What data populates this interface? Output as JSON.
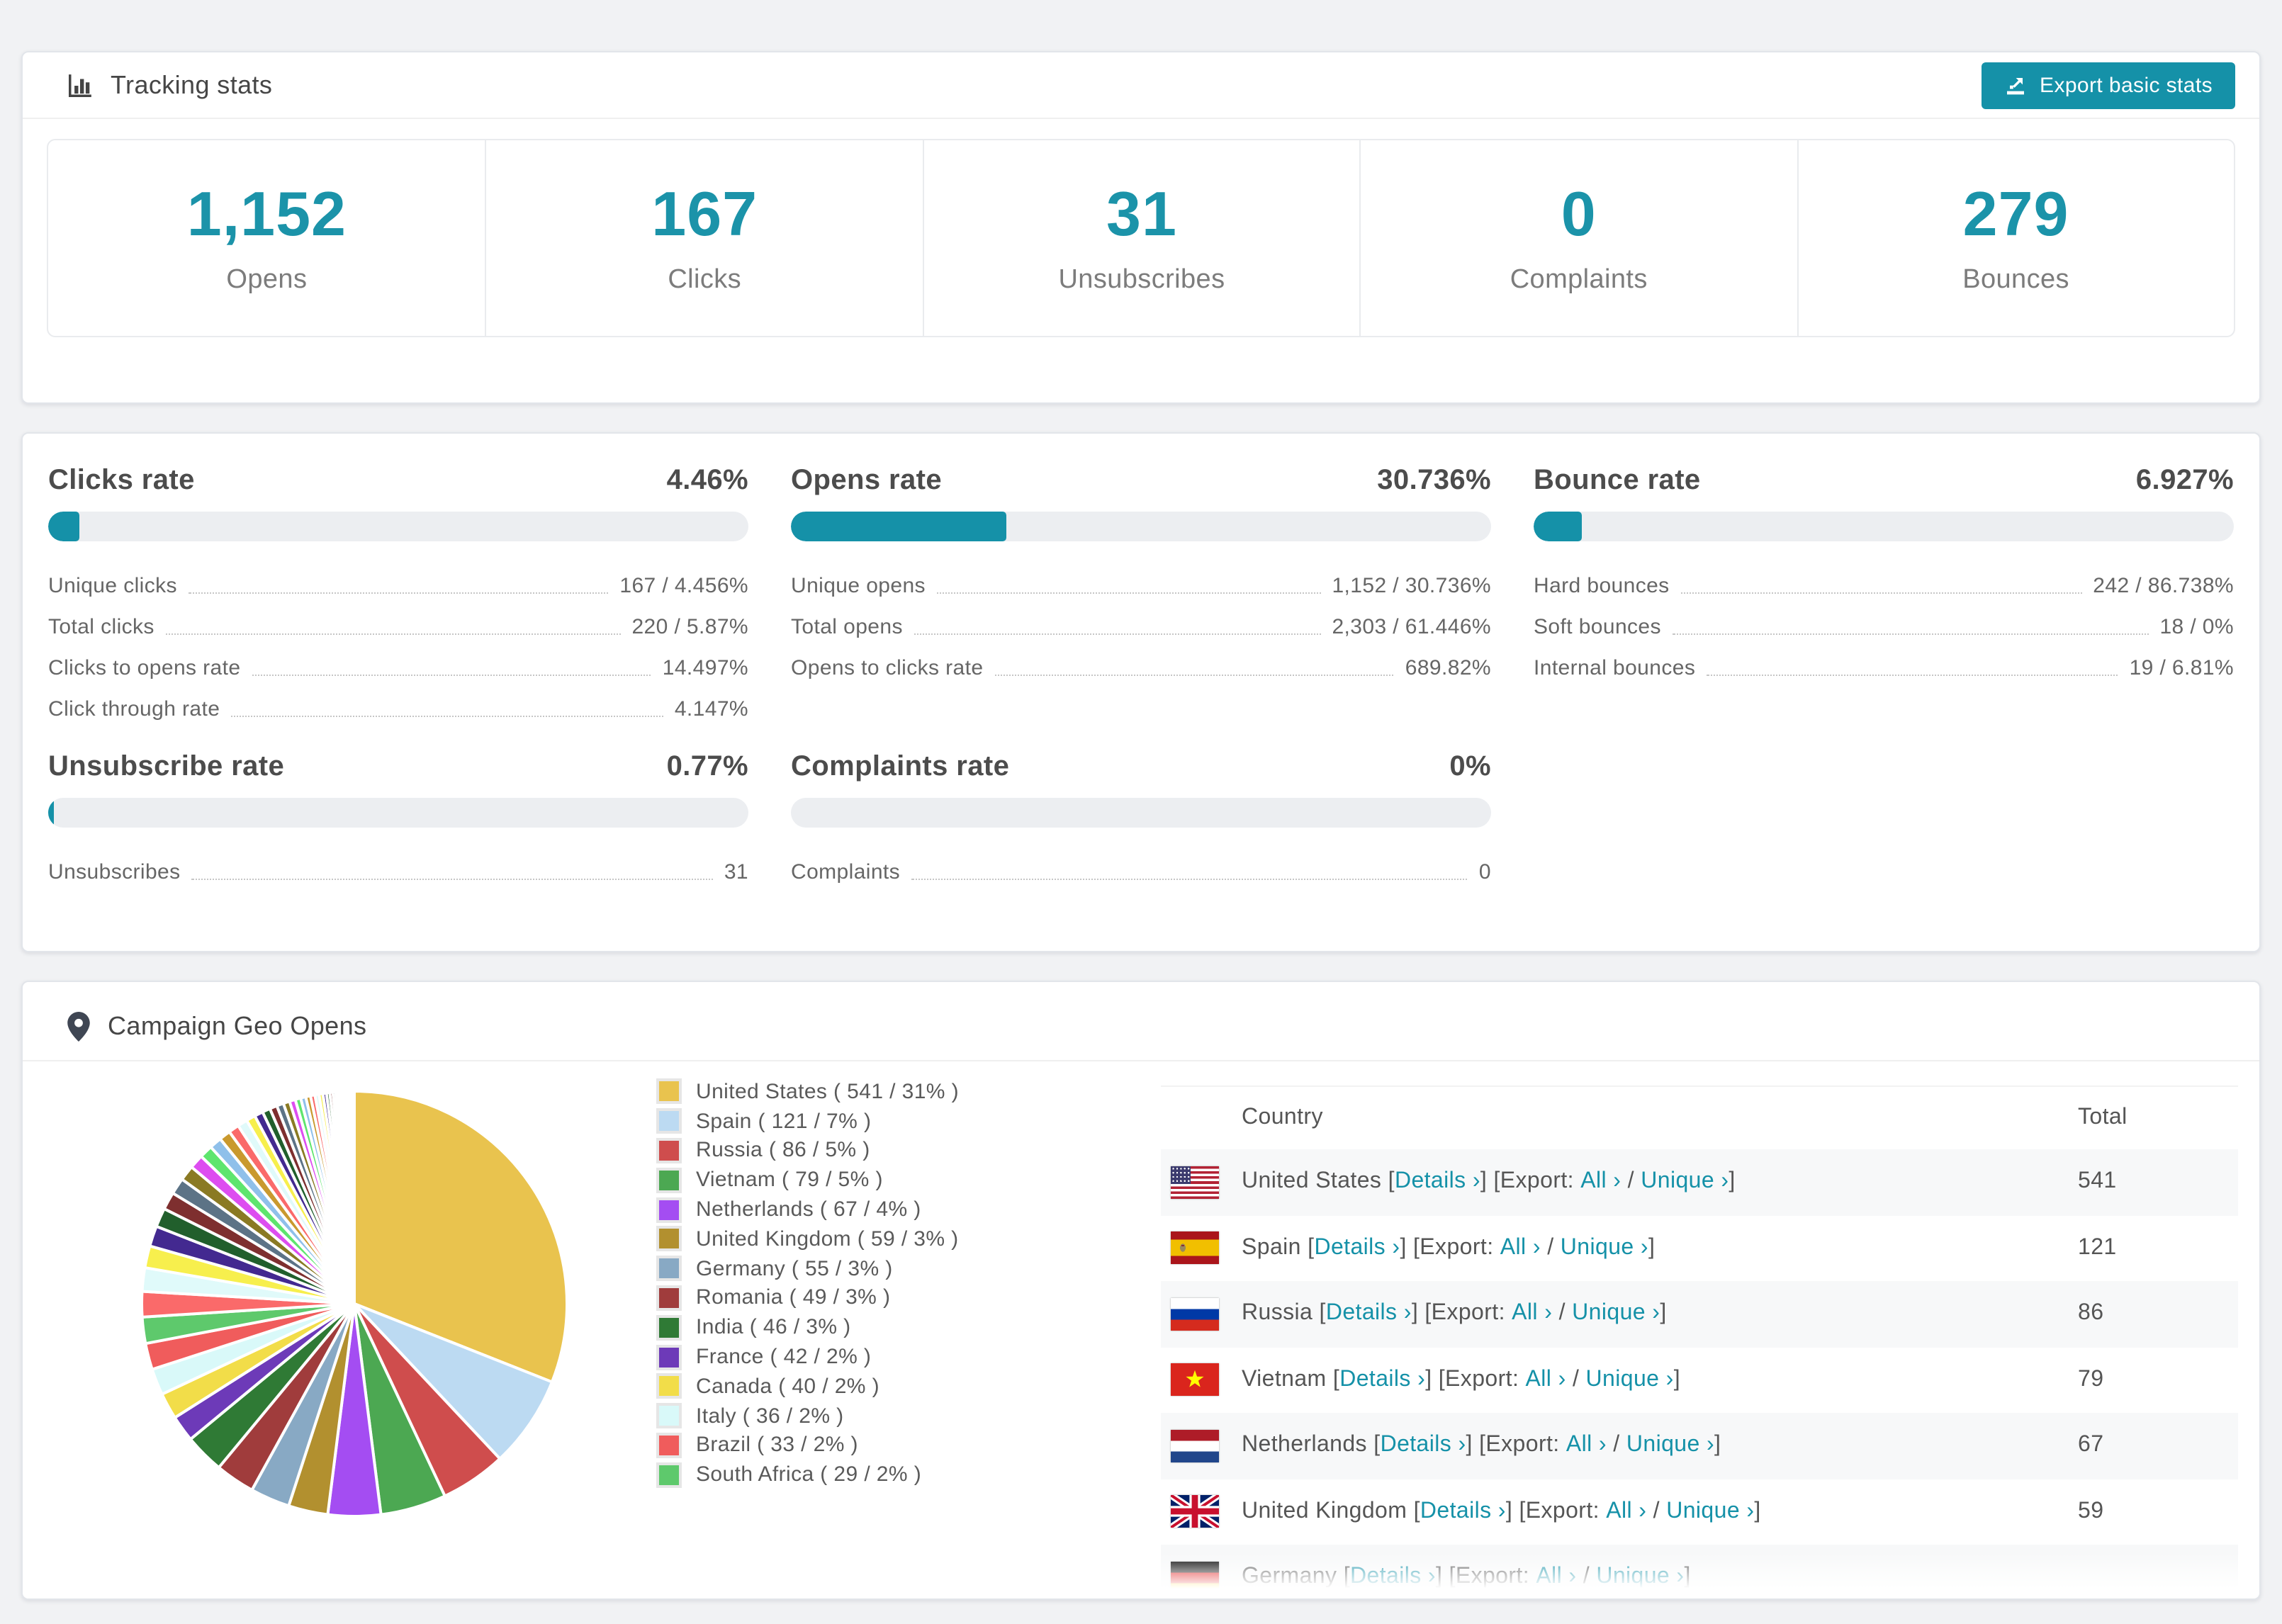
{
  "page_bg": "#f1f2f4",
  "accent": "#1591a8",
  "tracking": {
    "title": "Tracking stats",
    "export_button_label": "Export basic stats",
    "stats": [
      {
        "value": "1,152",
        "label": "Opens"
      },
      {
        "value": "167",
        "label": "Clicks"
      },
      {
        "value": "31",
        "label": "Unsubscribes"
      },
      {
        "value": "0",
        "label": "Complaints"
      },
      {
        "value": "279",
        "label": "Bounces"
      }
    ]
  },
  "rates": [
    {
      "title": "Clicks rate",
      "value": "4.46%",
      "percent": 4.46,
      "rows": [
        {
          "label": "Unique clicks",
          "value": "167 / 4.456%"
        },
        {
          "label": "Total clicks",
          "value": "220 / 5.87%"
        },
        {
          "label": "Clicks to opens rate",
          "value": "14.497%"
        },
        {
          "label": "Click through rate",
          "value": "4.147%"
        }
      ]
    },
    {
      "title": "Opens rate",
      "value": "30.736%",
      "percent": 30.736,
      "rows": [
        {
          "label": "Unique opens",
          "value": "1,152 / 30.736%"
        },
        {
          "label": "Total opens",
          "value": "2,303 / 61.446%"
        },
        {
          "label": "Opens to clicks rate",
          "value": "689.82%"
        }
      ]
    },
    {
      "title": "Bounce rate",
      "value": "6.927%",
      "percent": 6.927,
      "rows": [
        {
          "label": "Hard bounces",
          "value": "242 / 86.738%"
        },
        {
          "label": "Soft bounces",
          "value": "18 / 0%"
        },
        {
          "label": "Internal bounces",
          "value": "19 / 6.81%"
        }
      ]
    },
    {
      "title": "Unsubscribe rate",
      "value": "0.77%",
      "percent": 0.77,
      "rows": [
        {
          "label": "Unsubscribes",
          "value": "31"
        }
      ]
    },
    {
      "title": "Complaints rate",
      "value": "0%",
      "percent": 0,
      "rows": [
        {
          "label": "Complaints",
          "value": "0"
        }
      ]
    }
  ],
  "geo": {
    "title": "Campaign Geo Opens",
    "table": {
      "columns": [
        "Country",
        "Total"
      ],
      "details_label": "Details ›",
      "export_label": "Export:",
      "all_label": "All ›",
      "unique_label": "Unique ›",
      "rows": [
        {
          "country": "United States",
          "flag": "us",
          "total": "541"
        },
        {
          "country": "Spain",
          "flag": "es",
          "total": "121"
        },
        {
          "country": "Russia",
          "flag": "ru",
          "total": "86"
        },
        {
          "country": "Vietnam",
          "flag": "vn",
          "total": "79"
        },
        {
          "country": "Netherlands",
          "flag": "nl",
          "total": "67"
        },
        {
          "country": "United Kingdom",
          "flag": "gb",
          "total": "59"
        },
        {
          "country": "Germany",
          "flag": "de",
          "total": "",
          "partial": true
        }
      ]
    }
  },
  "chart_data": {
    "type": "pie",
    "title": "Campaign Geo Opens",
    "legend_position": "right",
    "start_angle_deg": 0,
    "direction": "clockwise",
    "slices": [
      {
        "label": "United States",
        "count": 541,
        "pct": 31,
        "color": "#e9c34e"
      },
      {
        "label": "Spain",
        "count": 121,
        "pct": 7,
        "color": "#bcdaf2"
      },
      {
        "label": "Russia",
        "count": 86,
        "pct": 5,
        "color": "#cf4d4d"
      },
      {
        "label": "Vietnam",
        "count": 79,
        "pct": 5,
        "color": "#4ca852"
      },
      {
        "label": "Netherlands",
        "count": 67,
        "pct": 4,
        "color": "#a44df2"
      },
      {
        "label": "United Kingdom",
        "count": 59,
        "pct": 3,
        "color": "#b2902f"
      },
      {
        "label": "Germany",
        "count": 55,
        "pct": 3,
        "color": "#88a9c4"
      },
      {
        "label": "Romania",
        "count": 49,
        "pct": 3,
        "color": "#a03c3c"
      },
      {
        "label": "India",
        "count": 46,
        "pct": 3,
        "color": "#2f7a35"
      },
      {
        "label": "France",
        "count": 42,
        "pct": 2,
        "color": "#6d3ab8"
      },
      {
        "label": "Canada",
        "count": 40,
        "pct": 2,
        "color": "#f2dd49"
      },
      {
        "label": "Italy",
        "count": 36,
        "pct": 2,
        "color": "#d9f9f9"
      },
      {
        "label": "Brazil",
        "count": 33,
        "pct": 2,
        "color": "#f05c5c"
      },
      {
        "label": "South Africa",
        "count": 29,
        "pct": 2,
        "color": "#5ec96c"
      }
    ],
    "unlabeled_remainder": {
      "total_pct": 26,
      "slice_count": 40,
      "decay": 0.93,
      "colors": [
        "#fa6a6a",
        "#e0fafa",
        "#f7ef4d",
        "#432990",
        "#215f2c",
        "#7e2f2f",
        "#5c7386",
        "#8a7a23",
        "#dd4df0",
        "#5ee56e",
        "#8fc0ea",
        "#c9992e"
      ]
    },
    "legend_format": {
      "open": " ( ",
      "sep": " / ",
      "close": "% )"
    }
  }
}
